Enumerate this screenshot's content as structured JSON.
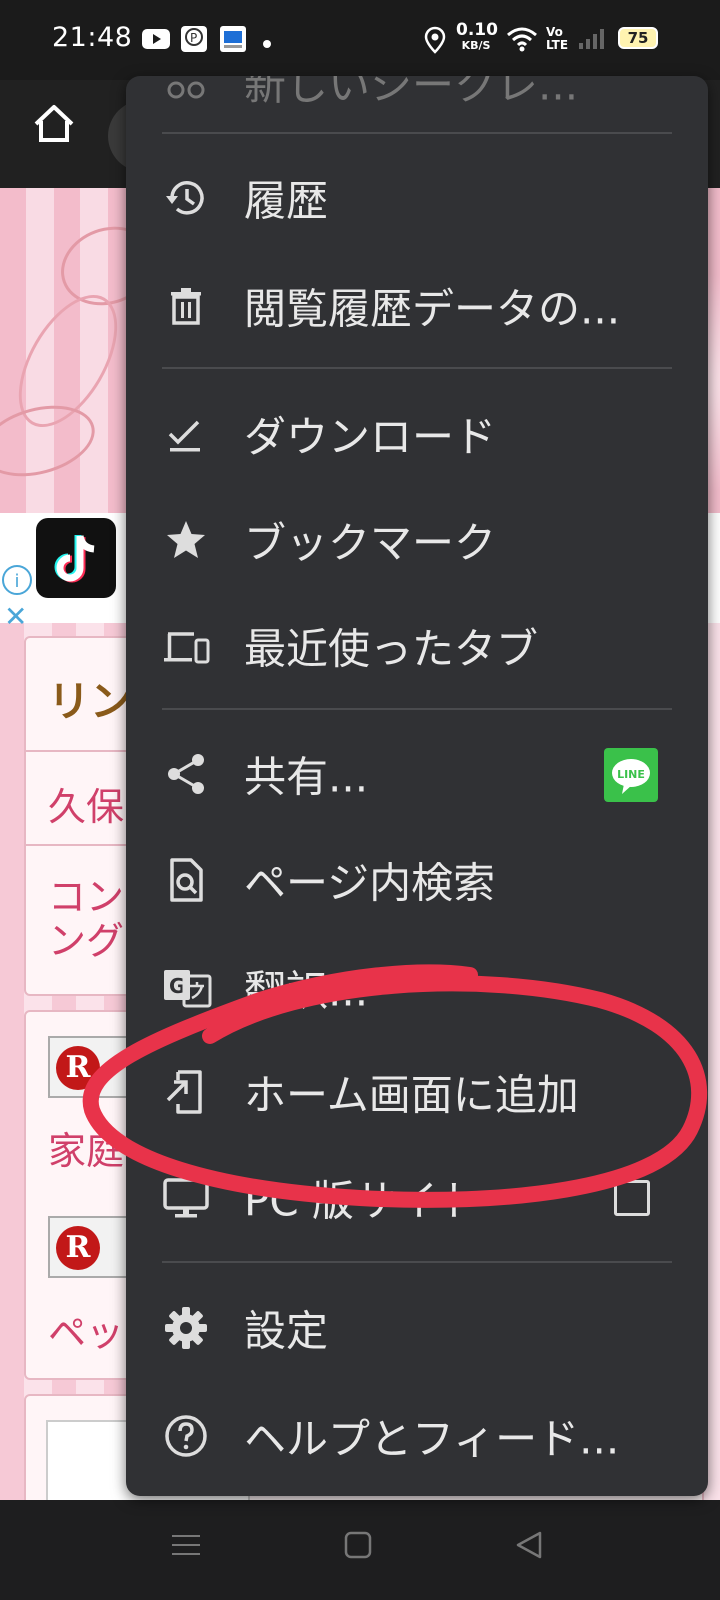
{
  "status_bar": {
    "time": "21:48",
    "net_speed_value": "0.10",
    "net_speed_unit": "KB/S",
    "volte_top": "Vo",
    "volte_bottom": "LTE",
    "battery": "75"
  },
  "page": {
    "card1_heading": "リン",
    "card1_row1": "久保",
    "card1_row2a": "コン",
    "card1_row2b": "ング",
    "card2_row1": "家庭",
    "card2_row2": "ペッ",
    "badge_letter": "R"
  },
  "menu": {
    "top_partial": "新しいシークレ...",
    "items": [
      {
        "label": "履歴",
        "icon": "history-icon"
      },
      {
        "label": "閲覧履歴データの...",
        "icon": "trash-icon"
      },
      {
        "label": "ダウンロード",
        "icon": "download-icon"
      },
      {
        "label": "ブックマーク",
        "icon": "star-icon"
      },
      {
        "label": "最近使ったタブ",
        "icon": "devices-icon"
      },
      {
        "label": "共有...",
        "icon": "share-icon"
      },
      {
        "label": "ページ内検索",
        "icon": "find-in-page-icon"
      },
      {
        "label": "翻訳...",
        "icon": "translate-icon"
      },
      {
        "label": "ホーム画面に追加",
        "icon": "add-to-home-icon"
      },
      {
        "label": "PC 版サイト",
        "icon": "desktop-icon"
      },
      {
        "label": "設定",
        "icon": "gear-icon"
      },
      {
        "label": "ヘルプとフィード...",
        "icon": "help-icon"
      }
    ],
    "line_badge": "LINE"
  },
  "colors": {
    "menu_bg": "#303134",
    "annotation": "#e8334a",
    "line_green": "#3ac14a"
  }
}
